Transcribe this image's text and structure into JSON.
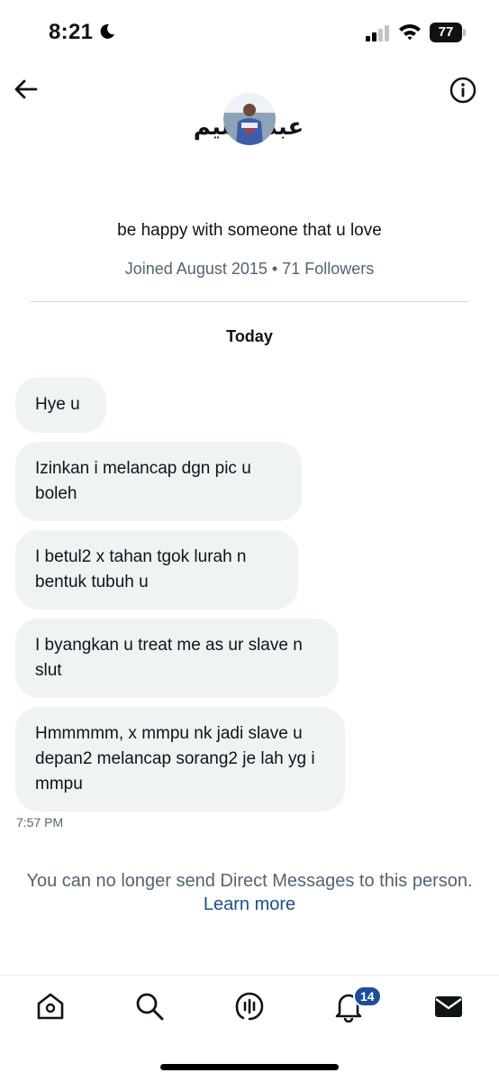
{
  "status_bar": {
    "time": "8:21",
    "battery": "77",
    "icons": [
      "moon-icon",
      "signal-icon",
      "wifi-icon",
      "battery-icon"
    ]
  },
  "header": {
    "profile_name": "عبدالحليم",
    "icons": [
      "back-arrow-icon",
      "info-icon",
      "avatar"
    ]
  },
  "profile": {
    "bio": "be happy with someone that u love",
    "meta": "Joined August 2015 • 71 Followers"
  },
  "conversation": {
    "day_label": "Today",
    "messages": [
      {
        "text": "Hye u"
      },
      {
        "text": "Izinkan i melancap dgn pic u boleh"
      },
      {
        "text": "I betul2 x tahan tgok lurah n bentuk tubuh u"
      },
      {
        "text": "I byangkan u treat me as ur slave n slut"
      },
      {
        "text": "Hmmmmm, x mmpu nk jadi slave u depan2 melancap sorang2 je lah yg i mmpu"
      }
    ],
    "last_time": "7:57 PM"
  },
  "footer_notice": {
    "text": "You can no longer send Direct Messages to this person.",
    "link": "Learn more"
  },
  "bottom_nav": {
    "items": [
      "home-icon",
      "search-icon",
      "spaces-icon",
      "notifications-icon",
      "messages-icon"
    ],
    "notification_badge": "14"
  },
  "colors": {
    "bubble": "#eff3f4",
    "secondary_text": "#536471",
    "link": "#1d4e89",
    "badge": "#1d4e9a"
  }
}
